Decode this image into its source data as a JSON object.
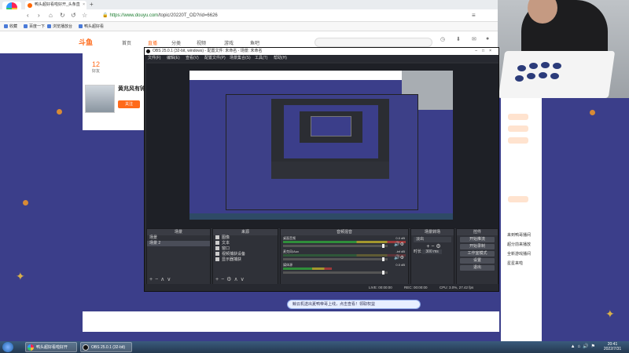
{
  "browser": {
    "logo_label": "云即播放",
    "tab_title": "鸭头超好看啦好开_头条直",
    "tab_close": "×",
    "new_tab": "+",
    "url_host": "https://www.douyu.com",
    "url_path": "/topic/20220T_OD?rid=6626",
    "bookmarks": [
      "收藏",
      "百度一下",
      "浏览播放台",
      "鸭头超好看"
    ]
  },
  "douyu": {
    "logo": "斗鱼",
    "nav": [
      "首页",
      "直播",
      "分类",
      "视频",
      "游戏",
      "鱼吧"
    ],
    "left_stat": "12",
    "left_stat_sub": "好友",
    "streamer_title": "黄兆风有钟",
    "follow_label": "关注",
    "promo_text": "鲸云机送出夏鸭帝哥上线，点击查看！领取权益",
    "right_items": [
      "来到鸭哥播间",
      "超分前来播放",
      "全新游戏播间",
      "星星来啦"
    ]
  },
  "obs": {
    "title": "OBS 25.0.1 (32-bit, windows) - 配置文件: 未命名 - 场景: 未命名",
    "menu": [
      "文件(F)",
      "编辑(E)",
      "查看(V)",
      "配置文件(P)",
      "场景集合(S)",
      "工具(T)",
      "帮助(H)"
    ],
    "docks": {
      "scenes": {
        "title": "场景",
        "items": [
          "场景",
          "场景 2"
        ]
      },
      "sources": {
        "title": "来源",
        "items": [
          "图像",
          "文本",
          "窗口",
          "视频捕获设备",
          "显示器捕获"
        ]
      },
      "mixer": {
        "title": "音频混音",
        "channels": [
          {
            "name": "桌面音频",
            "value": "0.0 dB"
          },
          {
            "name": "麦克风/Aux",
            "value": "-inf dB"
          },
          {
            "name": "媒体源",
            "value": "0.0 dB"
          }
        ]
      },
      "transitions": {
        "title": "场景转场",
        "type": "淡出",
        "duration_label": "时长",
        "duration": "300 ms"
      },
      "controls": {
        "title": "控件",
        "buttons": [
          "开始推流",
          "开始录制",
          "工作室模式",
          "设置",
          "退出"
        ]
      }
    },
    "status": {
      "live": "LIVE: 00:00:00",
      "rec": "REC: 00:00:00",
      "cpu": "CPU: 3.0%, 27.42 fps"
    }
  },
  "taskbar": {
    "items": [
      "鸭头超好看啦好开",
      "OBS 25.0.1 (32-bit)"
    ],
    "time": "20:41",
    "date": "2022/7/31"
  }
}
